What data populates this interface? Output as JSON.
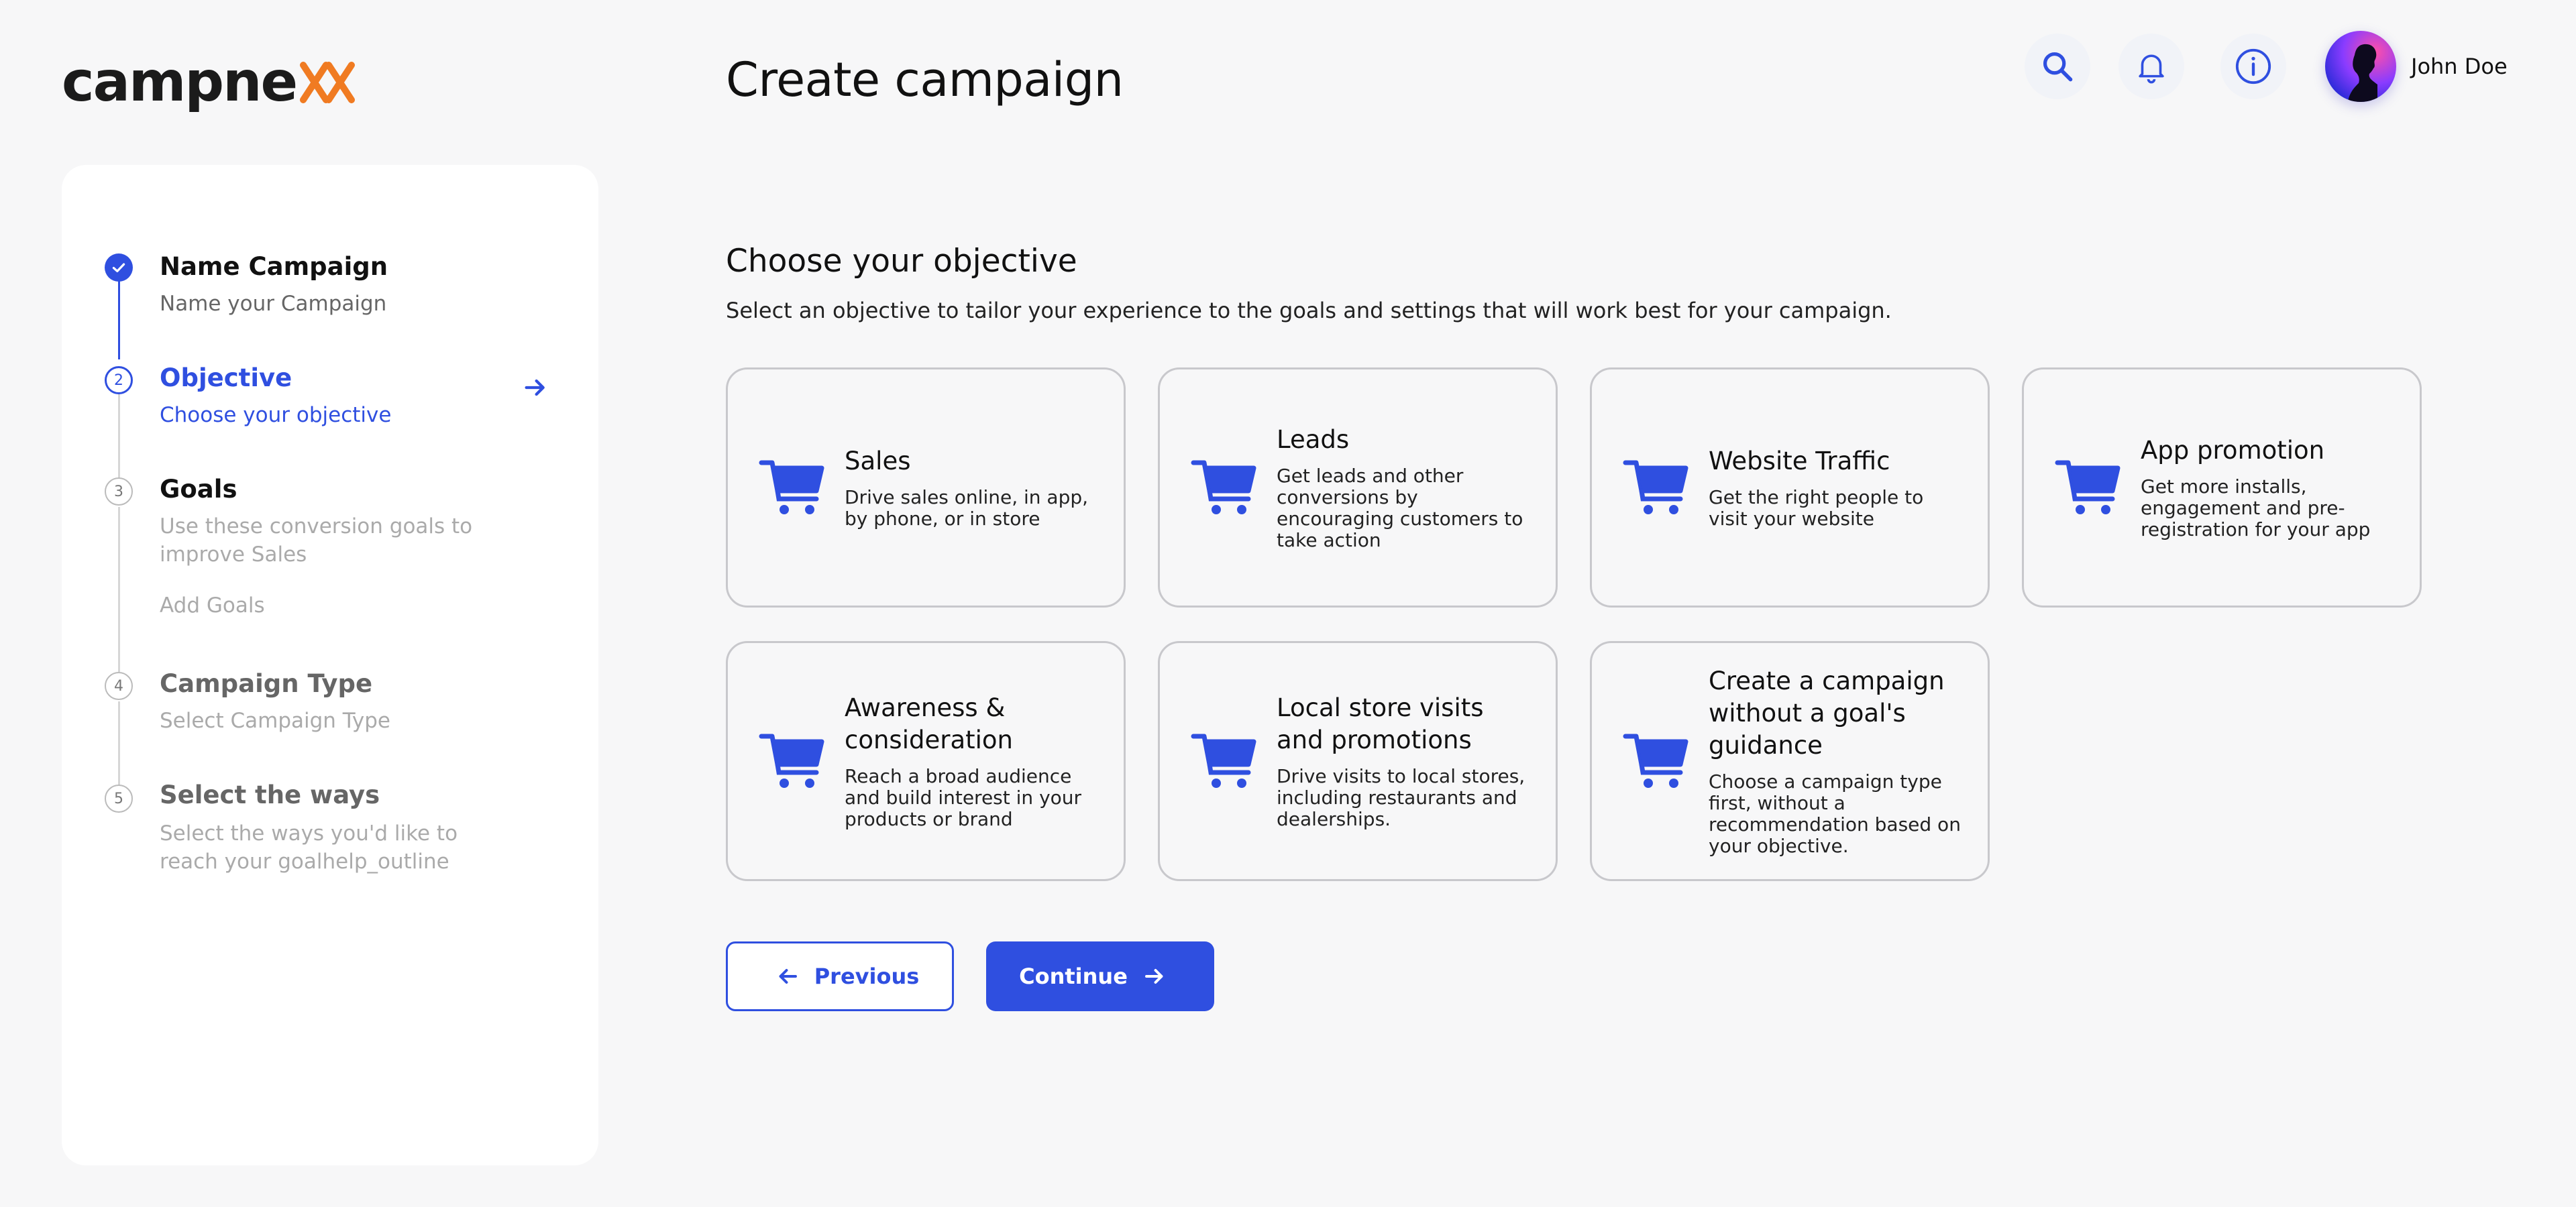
{
  "header": {
    "logo_text": "campne",
    "page_title": "Create campaign",
    "user_name": "John Doe",
    "icons": [
      "search-icon",
      "bell-icon",
      "info-icon"
    ]
  },
  "colors": {
    "accent": "#2f4fe0",
    "logo_orange": "#f07b22",
    "background": "#f7f7f8"
  },
  "steps": [
    {
      "number": "1",
      "title": "Name Campaign",
      "subtitle": "Name your Campaign",
      "state": "completed"
    },
    {
      "number": "2",
      "title": "Objective",
      "subtitle": "Choose your objective",
      "state": "active"
    },
    {
      "number": "3",
      "title": "Goals",
      "subtitle": "Use these conversion goals to improve Sales",
      "extra": "Add Goals",
      "state": "upcoming"
    },
    {
      "number": "4",
      "title": "Campaign Type",
      "subtitle": "Select Campaign Type",
      "state": "disabled"
    },
    {
      "number": "5",
      "title": "Select the ways",
      "subtitle": "Select the ways you'd like to reach your goalhelp_outline",
      "state": "disabled"
    }
  ],
  "main": {
    "section_title": "Choose your objective",
    "section_desc": "Select an objective to tailor your experience to the goals and settings that will work best for your campaign.",
    "objectives": [
      {
        "title": "Sales",
        "desc": "Drive sales online, in app, by phone, or in store",
        "icon": "cart-icon"
      },
      {
        "title": "Leads",
        "desc": "Get leads and other conversions by encouraging customers to take action",
        "icon": "cart-icon"
      },
      {
        "title": "Website Traffic",
        "desc": "Get the right people to visit your website",
        "icon": "cart-icon"
      },
      {
        "title": "App promotion",
        "desc": "Get more installs, engagement and pre-registration for your app",
        "icon": "cart-icon"
      },
      {
        "title": "Awareness & consideration",
        "desc": "Reach a broad audience and build interest in your products or brand",
        "icon": "cart-icon"
      },
      {
        "title": "Local store visits and promotions",
        "desc": "Drive visits to local stores, including restaurants and dealerships.",
        "icon": "cart-icon"
      },
      {
        "title": "Create a campaign without a goal's guidance",
        "desc": "Choose a campaign type first, without a recommendation based on your objective.",
        "icon": "cart-icon"
      }
    ]
  },
  "actions": {
    "previous_label": "Previous",
    "continue_label": "Continue"
  }
}
